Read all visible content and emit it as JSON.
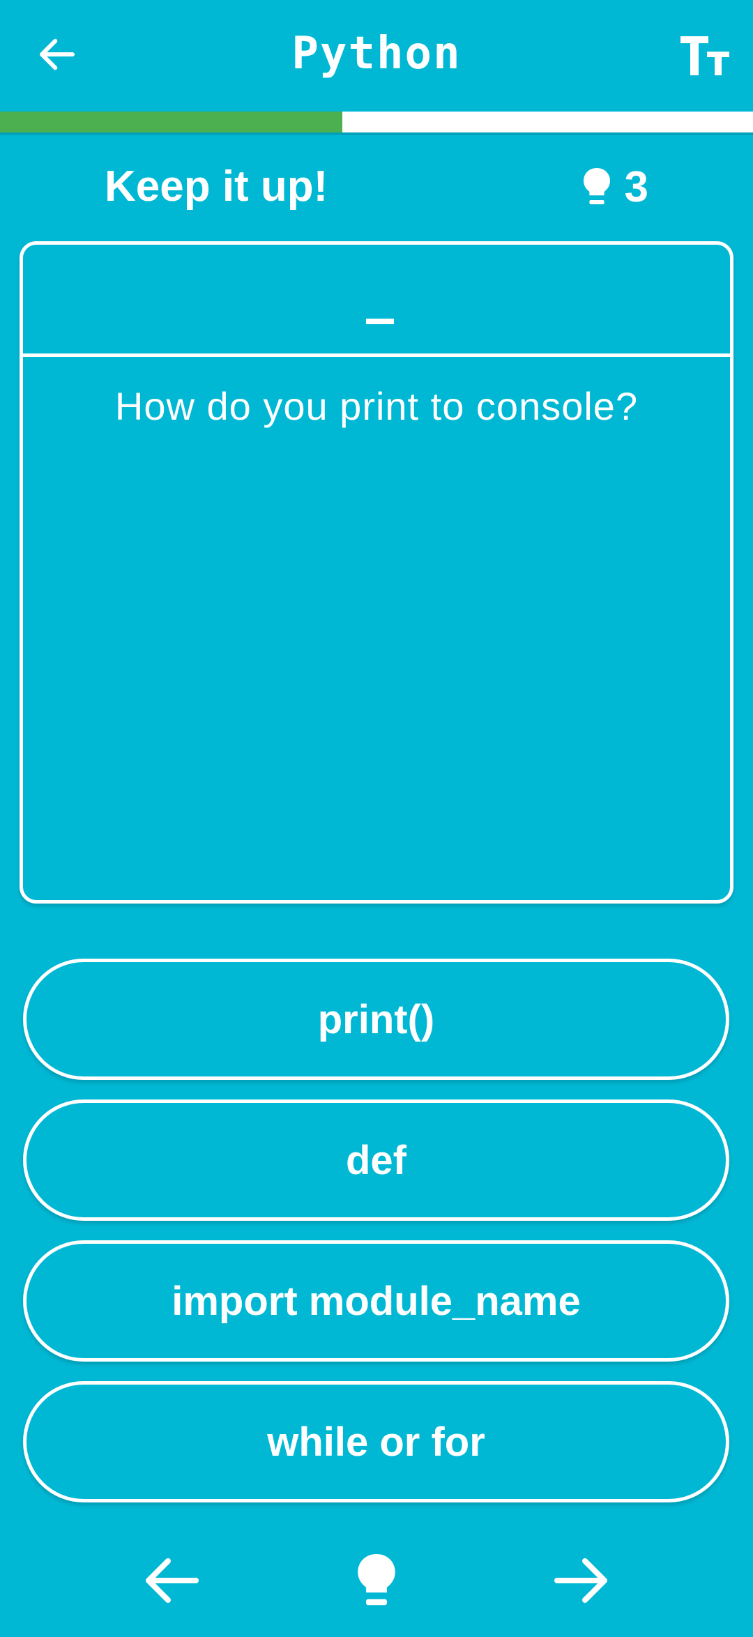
{
  "header": {
    "title": "Python",
    "back_icon": "arrow-left-icon",
    "text_size_icon": "text-size-icon"
  },
  "progress": {
    "fraction": 0.455,
    "fill_color": "#4CAF50",
    "track_color": "#ffffff"
  },
  "status": {
    "message": "Keep it up!",
    "hint_icon": "lightbulb-icon",
    "hints_remaining": "3"
  },
  "card": {
    "answer_placeholder": "_",
    "question": "How do you print to console?"
  },
  "options": [
    {
      "label": "print()"
    },
    {
      "label": "def"
    },
    {
      "label": "import module_name"
    },
    {
      "label": "while or for"
    }
  ],
  "bottom_nav": {
    "prev_icon": "arrow-left-icon",
    "hint_icon": "lightbulb-icon",
    "next_icon": "arrow-right-icon"
  },
  "colors": {
    "background": "#00B8D4",
    "foreground": "#ffffff",
    "progress": "#4CAF50"
  }
}
